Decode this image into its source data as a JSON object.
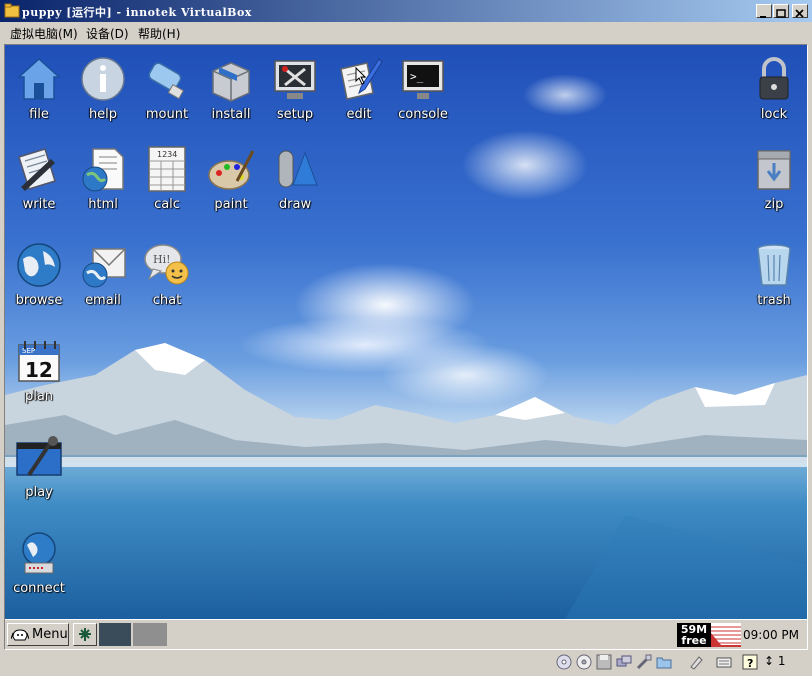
{
  "window": {
    "title": "puppy [运行中] - innotek VirtualBox",
    "minimize_label": "_",
    "maximize_label": "□",
    "close_label": "×"
  },
  "menubar": {
    "items": [
      "虚拟电脑(M)",
      "设备(D)",
      "帮助(H)"
    ]
  },
  "desktop": {
    "icons": [
      {
        "label": "file",
        "icon": "home-folder-icon"
      },
      {
        "label": "help",
        "icon": "info-icon"
      },
      {
        "label": "mount",
        "icon": "usb-drive-icon"
      },
      {
        "label": "install",
        "icon": "package-box-icon"
      },
      {
        "label": "setup",
        "icon": "tools-monitor-icon"
      },
      {
        "label": "edit",
        "icon": "notepad-pen-icon"
      },
      {
        "label": "console",
        "icon": "terminal-icon"
      },
      {
        "label": "lock",
        "icon": "padlock-icon"
      },
      {
        "label": "write",
        "icon": "document-pen-icon"
      },
      {
        "label": "html",
        "icon": "web-document-icon"
      },
      {
        "label": "calc",
        "icon": "spreadsheet-icon"
      },
      {
        "label": "paint",
        "icon": "palette-icon"
      },
      {
        "label": "draw",
        "icon": "shapes-icon"
      },
      {
        "label": "zip",
        "icon": "archive-box-icon"
      },
      {
        "label": "browse",
        "icon": "globe-icon"
      },
      {
        "label": "email",
        "icon": "envelope-globe-icon"
      },
      {
        "label": "chat",
        "icon": "chat-bubble-icon"
      },
      {
        "label": "trash",
        "icon": "trash-can-icon"
      },
      {
        "label": "plan",
        "icon": "calendar-icon"
      },
      {
        "label": "play",
        "icon": "media-player-icon"
      },
      {
        "label": "connect",
        "icon": "network-globe-icon"
      }
    ],
    "calendar_month": "SEP",
    "calendar_day": "12",
    "calc_header": "1234",
    "console_prompt": ">_",
    "chat_text": "Hi!",
    "html_text": "HTML"
  },
  "taskbar": {
    "menu_label": "Menu",
    "free_memory_amount": "59M",
    "free_memory_label": "free",
    "clock": "09:00 PM"
  },
  "statusbar": {
    "host_key_count": "1",
    "icons": [
      "cd-icon",
      "floppy-icon",
      "network-icon",
      "shared-folder-icon",
      "usb-icon",
      "mouse-integration-icon",
      "keyboard-capture-icon",
      "help-icon"
    ]
  },
  "colors": {
    "title_gradient_start": "#0a246a",
    "title_gradient_end": "#a6caf0",
    "chrome": "#d4d0c8",
    "sky": "#3a72d0",
    "lake": "#3f8cc5"
  }
}
